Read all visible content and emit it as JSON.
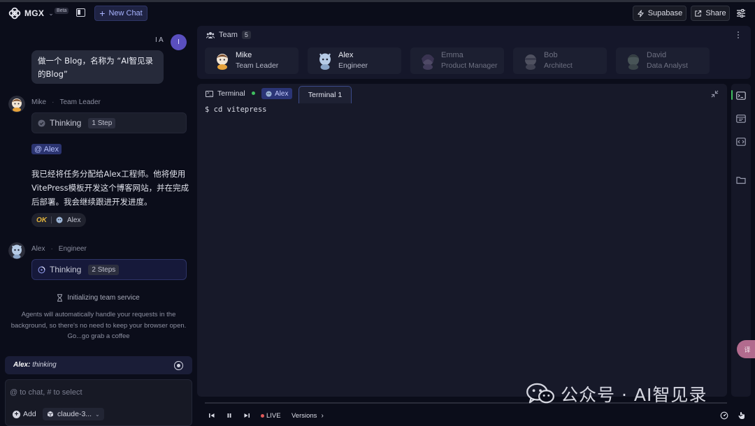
{
  "header": {
    "brand": "MGX",
    "beta_badge": "Beta",
    "new_chat_label": "New Chat",
    "supabase_label": "Supabase",
    "share_label": "Share"
  },
  "chat": {
    "user_initials": "I A",
    "user_avatar_letter": "I",
    "user_message": "做一个 Blog，名称为 “AI智见录的Blog”",
    "mike": {
      "name": "Mike",
      "role": "Team Leader",
      "thinking": "Thinking",
      "steps": "1 Step"
    },
    "mention": "@ Alex",
    "mike_reply": "我已经将任务分配给Alex工程师。他将使用VitePress模板开发这个博客网站，并在完成后部署。我会继续跟进开发进度。",
    "ok_label": "OK",
    "ok_agent": "Alex",
    "alex": {
      "name": "Alex",
      "role": "Engineer",
      "thinking": "Thinking",
      "steps": "2 Steps"
    },
    "init_status": "Initializing team service",
    "notice": "Agents will automatically handle your requests in the background, so there's no need to keep your browser open. Go...go grab a coffee",
    "status_agent": "Alex:",
    "status_text": "thinking",
    "composer_placeholder": "@ to chat, # to select",
    "add_label": "Add",
    "model_label": "claude-3..."
  },
  "team": {
    "title": "Team",
    "count": "5",
    "members": [
      {
        "name": "Mike",
        "role": "Team Leader"
      },
      {
        "name": "Alex",
        "role": "Engineer"
      },
      {
        "name": "Emma",
        "role": "Product Manager"
      },
      {
        "name": "Bob",
        "role": "Architect"
      },
      {
        "name": "David",
        "role": "Data Analyst"
      }
    ]
  },
  "terminal": {
    "title": "Terminal",
    "agent_chip": "Alex",
    "tab_label": "Terminal 1",
    "output": "$ cd vitepress"
  },
  "player": {
    "live_label": "LIVE",
    "versions_label": "Versions"
  },
  "translate_label": "译",
  "watermark": "公众号 · AI智见录",
  "colors": {
    "accent": "#a7b3ff",
    "live": "#3fbf5f",
    "ok": "#e3b43c",
    "background": "#0b0d1a"
  }
}
